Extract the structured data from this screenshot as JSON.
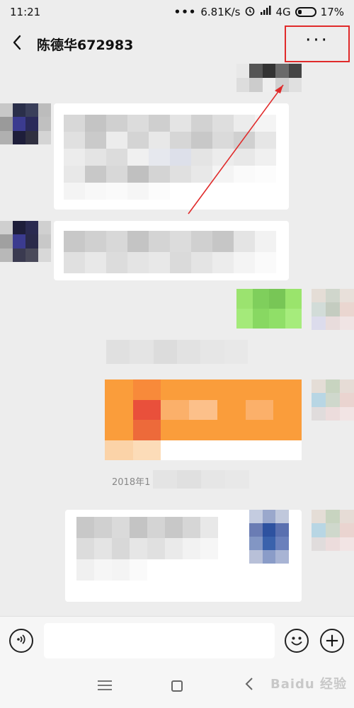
{
  "status_bar": {
    "time": "11:21",
    "dots": "•••",
    "speed": "6.81K/s",
    "network": "4G",
    "battery": "17%"
  },
  "header": {
    "title": "陈德华672983",
    "back_icon": "chevron-left-icon",
    "more_icon": "more-dots-icon",
    "more_label": "···"
  },
  "chat": {
    "timestamp": "2018年1"
  },
  "input_bar": {
    "placeholder": "",
    "voice_icon": "voice-icon",
    "emoji_icon": "emoji-icon",
    "plus_icon": "plus-icon",
    "plus_label": "+"
  },
  "nav_bar": {
    "watermark": "Baidu 经验"
  },
  "colors": {
    "background": "#ededed",
    "bubble_self": "#95ec69",
    "bubble_card": "#fa9d3b",
    "annotation": "#e02a2a"
  }
}
